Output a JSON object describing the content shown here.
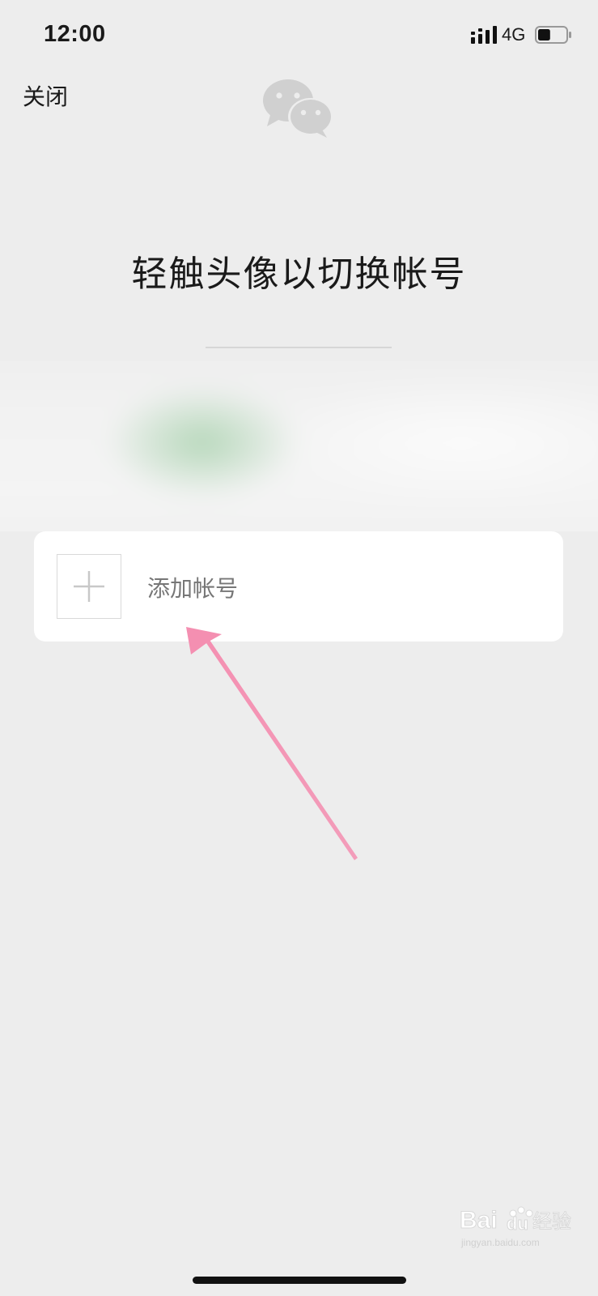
{
  "status_bar": {
    "time": "12:00",
    "network": "4G",
    "battery_level": 0.45
  },
  "header": {
    "close_label": "关闭"
  },
  "main": {
    "title": "轻触头像以切换帐号",
    "add_account_label": "添加帐号"
  },
  "watermark": {
    "brand": "Baidu经验",
    "url": "jingyan.baidu.com"
  },
  "colors": {
    "background": "#ededed",
    "card": "#ffffff",
    "annotation_arrow": "#f48fb1"
  }
}
